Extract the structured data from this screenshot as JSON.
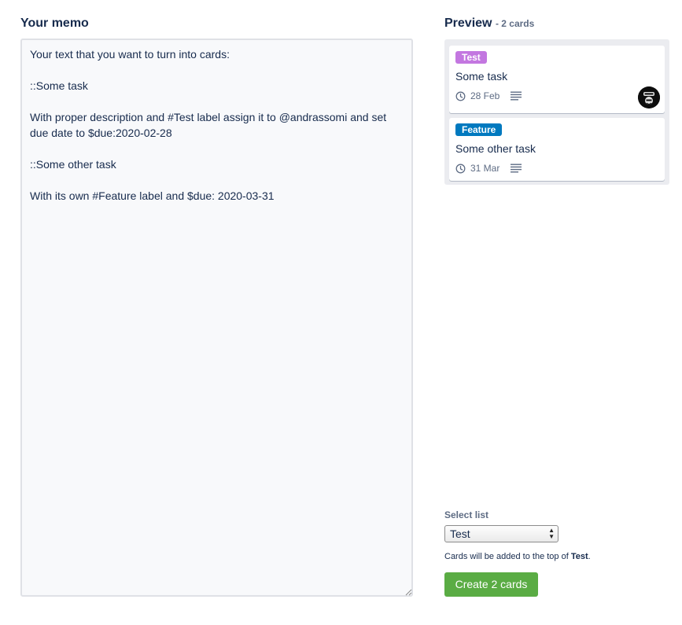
{
  "memo": {
    "title": "Your memo",
    "text": "Your text that you want to turn into cards:\n\n::Some task\n\nWith proper description and #Test label assign it to @andrassomi and set due date to $due:2020-02-28\n\n::Some other task\n\nWith its own #Feature label and $due: 2020-03-31"
  },
  "preview": {
    "title": "Preview",
    "count_text": "- 2 cards",
    "cards": [
      {
        "label": "Test",
        "label_color": "#c377e0",
        "title": "Some task",
        "due": "28 Feb",
        "has_description": true,
        "has_avatar": true,
        "icons": [
          "clock-icon",
          "description-icon",
          "avatar"
        ]
      },
      {
        "label": "Feature",
        "label_color": "#0079bf",
        "title": "Some other task",
        "due": "31 Mar",
        "has_description": true,
        "has_avatar": false,
        "icons": [
          "clock-icon",
          "description-icon"
        ]
      }
    ]
  },
  "list_select": {
    "label": "Select list",
    "selected": "Test",
    "hint_prefix": "Cards will be added to the top of",
    "hint_list": "Test",
    "hint_suffix": "."
  },
  "create_button": {
    "label": "Create 2 cards",
    "color": "#5aac44"
  }
}
